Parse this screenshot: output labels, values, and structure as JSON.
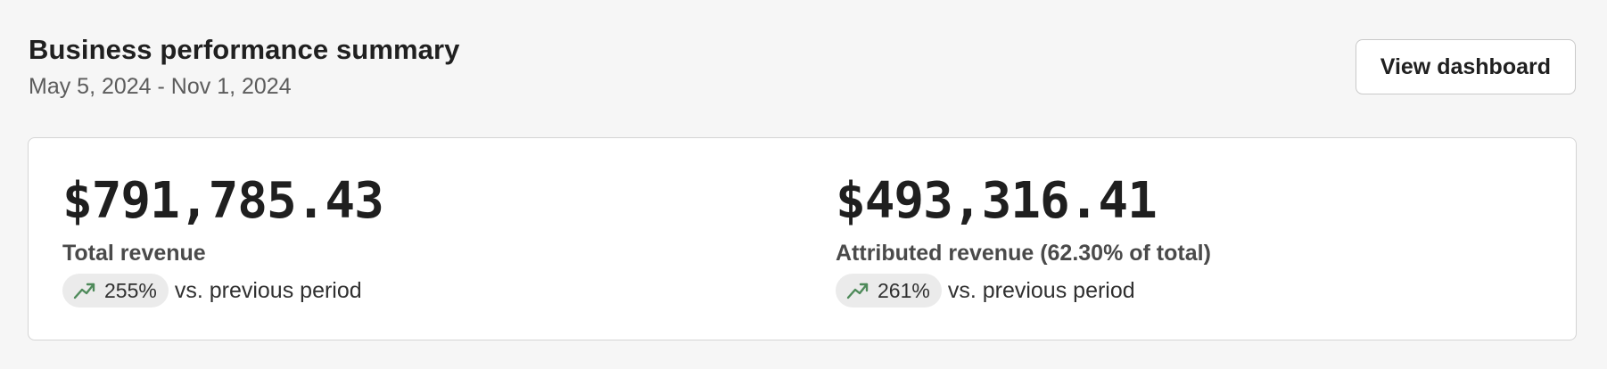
{
  "header": {
    "title": "Business performance summary",
    "date_range": "May 5, 2024 - Nov 1, 2024",
    "view_button_label": "View dashboard"
  },
  "metrics": [
    {
      "value": "$791,785.43",
      "label": "Total revenue",
      "change": "255%",
      "change_suffix": "vs. previous period",
      "trend_icon": "trending-up-icon"
    },
    {
      "value": "$493,316.41",
      "label": "Attributed revenue (62.30% of total)",
      "change": "261%",
      "change_suffix": "vs. previous period",
      "trend_icon": "trending-up-icon"
    }
  ],
  "colors": {
    "page_background": "#f6f6f6",
    "card_background": "#ffffff",
    "trend_up": "#4e8a5a",
    "badge_background": "#ebebeb"
  }
}
